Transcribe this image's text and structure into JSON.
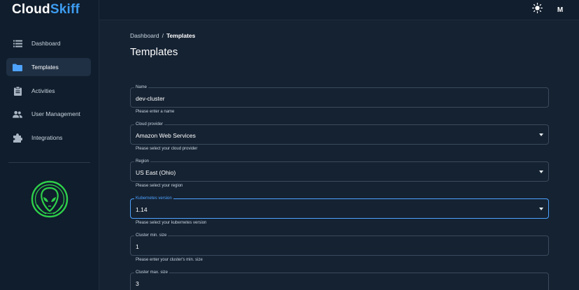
{
  "app": {
    "logo_part1": "Cloud",
    "logo_part2": "Skiff"
  },
  "sidebar": {
    "items": [
      {
        "label": "Dashboard",
        "icon": "list-icon"
      },
      {
        "label": "Templates",
        "icon": "folder-icon",
        "active": true
      },
      {
        "label": "Activities",
        "icon": "clipboard-icon"
      },
      {
        "label": "User Management",
        "icon": "users-icon"
      },
      {
        "label": "Integrations",
        "icon": "puzzle-icon"
      }
    ]
  },
  "header": {
    "avatar_initial": "M",
    "theme_icon": "sun-icon"
  },
  "breadcrumb": {
    "parent": "Dashboard",
    "separator": "/",
    "current": "Templates"
  },
  "page": {
    "title": "Templates"
  },
  "form": {
    "fields": [
      {
        "label": "Name",
        "value": "dev-cluster",
        "helper": "Please enter a name"
      },
      {
        "label": "Cloud provider",
        "value": "Amazon Web Services",
        "helper": "Please select your cloud provider"
      },
      {
        "label": "Region",
        "value": "US East (Ohio)",
        "helper": "Please select your region"
      },
      {
        "label": "Kubernetes version",
        "value": "1.14",
        "helper": "Please select your kubernetes version"
      },
      {
        "label": "Cluster min. size",
        "value": "1",
        "helper": "Please enter your cluster's min. size"
      },
      {
        "label": "Cluster max. size",
        "value": "3"
      }
    ]
  },
  "colors": {
    "accent": "#4ea3ff",
    "logo_accent": "#3d9cf0",
    "badge_green": "#2ed14a",
    "background": "#152232",
    "sidebar": "#101d2c"
  }
}
